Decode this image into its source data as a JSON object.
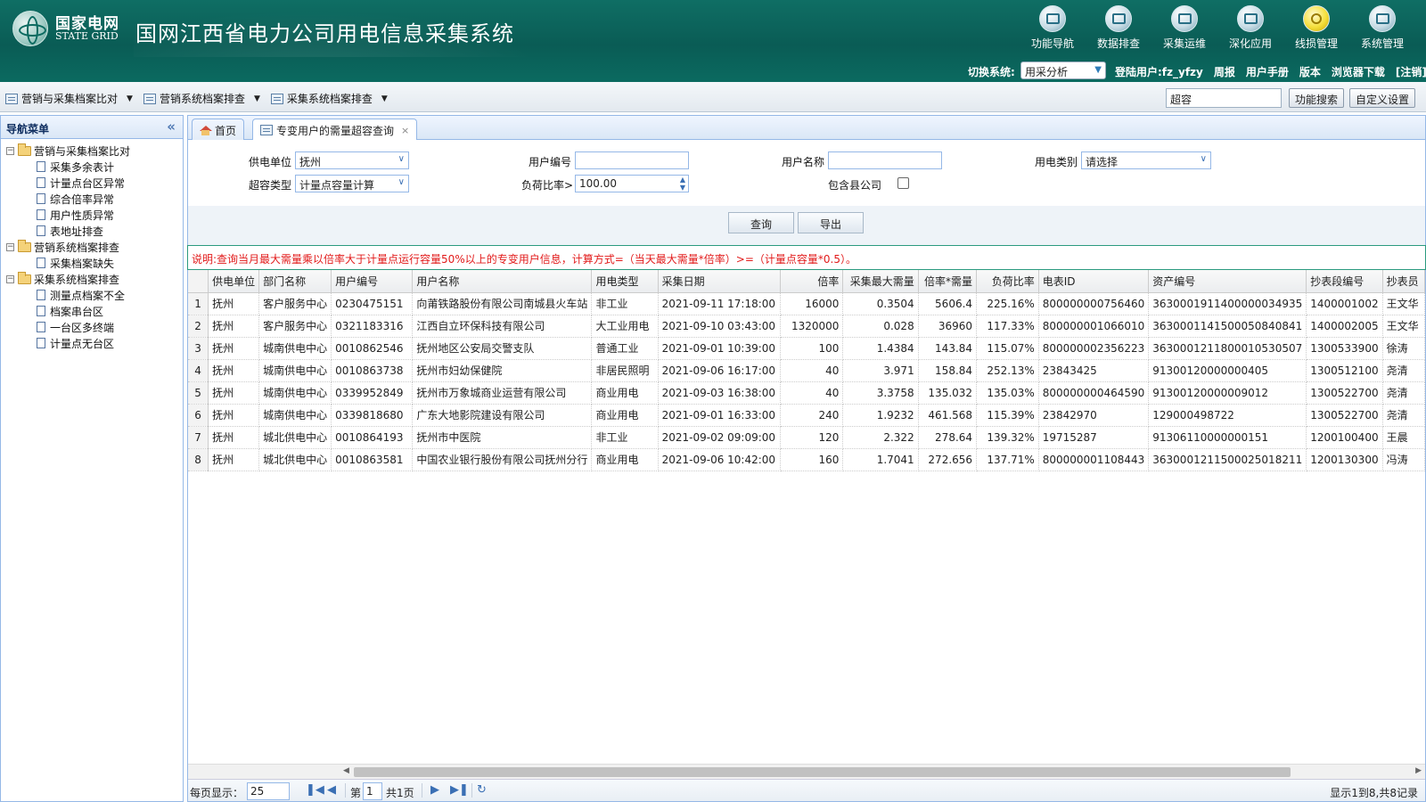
{
  "header": {
    "logo_cn": "国家电网",
    "logo_en": "STATE GRID",
    "system_title": "国网江西省电力公司用电信息采集系统",
    "nav": [
      {
        "label": "功能导航",
        "icon": "navigation-icon"
      },
      {
        "label": "数据排查",
        "icon": "data-check-icon"
      },
      {
        "label": "采集运维",
        "icon": "maintenance-icon"
      },
      {
        "label": "深化应用",
        "icon": "application-icon"
      },
      {
        "label": "线损管理",
        "icon": "bulb-icon"
      },
      {
        "label": "系统管理",
        "icon": "system-icon"
      }
    ],
    "switch_label": "切换系统:",
    "switch_value": "用采分析",
    "login_user": "登陆用户:fz_yfzy",
    "links": [
      "周报",
      "用户手册",
      "版本",
      "浏览器下载",
      "[注销]"
    ]
  },
  "toolbar": {
    "menus": [
      "营销与采集档案比对",
      "营销系统档案排查",
      "采集系统档案排查"
    ],
    "search_value": "超容",
    "search_button": "功能搜索",
    "custom_button": "自定义设置"
  },
  "leftnav": {
    "title": "导航菜单",
    "groups": [
      {
        "label": "营销与采集档案比对",
        "items": [
          "采集多余表计",
          "计量点台区异常",
          "综合倍率异常",
          "用户性质异常",
          "表地址排查"
        ]
      },
      {
        "label": "营销系统档案排查",
        "items": [
          "采集档案缺失"
        ]
      },
      {
        "label": "采集系统档案排查",
        "items": [
          "测量点档案不全",
          "档案串台区",
          "一台区多终端",
          "计量点无台区"
        ]
      }
    ]
  },
  "tabs": {
    "home": "首页",
    "active": "专变用户的需量超容查询"
  },
  "query": {
    "supply_unit_label": "供电单位",
    "supply_unit_value": "抚州",
    "user_no_label": "用户编号",
    "user_no_value": "",
    "user_name_label": "用户名称",
    "user_name_value": "",
    "elec_type_label": "用电类别",
    "elec_type_value": "请选择",
    "over_type_label": "超容类型",
    "over_type_value": "计量点容量计算",
    "load_ratio_label": "负荷比率>",
    "load_ratio_value": "100.00",
    "include_county_label": "包含县公司",
    "query_button": "查询",
    "export_button": "导出"
  },
  "notice": "说明:查询当月最大需量乘以倍率大于计量点运行容量50%以上的专变用户信息，计算方式=（当天最大需量*倍率）>=（计量点容量*0.5）。",
  "table": {
    "columns": [
      "",
      "供电单位",
      "部门名称",
      "用户编号",
      "用户名称",
      "用电类型",
      "采集日期",
      "倍率",
      "采集最大需量",
      "倍率*需量",
      "负荷比率",
      "电表ID",
      "资产编号",
      "抄表段编号",
      "抄表员"
    ],
    "rows": [
      [
        "1",
        "抚州",
        "客户服务中心",
        "0230475151",
        "向莆铁路股份有限公司南城县火车站",
        "非工业",
        "2021-09-11 17:18:00",
        "16000",
        "0.3504",
        "5606.4",
        "225.16%",
        "800000000756460",
        "3630001911400000034935",
        "1400001002",
        "王文华"
      ],
      [
        "2",
        "抚州",
        "客户服务中心",
        "0321183316",
        "江西自立环保科技有限公司",
        "大工业用电",
        "2021-09-10 03:43:00",
        "1320000",
        "0.028",
        "36960",
        "117.33%",
        "800000001066010",
        "3630001141500050840841",
        "1400002005",
        "王文华"
      ],
      [
        "3",
        "抚州",
        "城南供电中心",
        "0010862546",
        "抚州地区公安局交警支队",
        "普通工业",
        "2021-09-01 10:39:00",
        "100",
        "1.4384",
        "143.84",
        "115.07%",
        "800000002356223",
        "3630001211800010530507",
        "1300533900",
        "徐涛"
      ],
      [
        "4",
        "抚州",
        "城南供电中心",
        "0010863738",
        "抚州市妇幼保健院",
        "非居民照明",
        "2021-09-06 16:17:00",
        "40",
        "3.971",
        "158.84",
        "252.13%",
        "23843425",
        "91300120000000405",
        "1300512100",
        "尧清"
      ],
      [
        "5",
        "抚州",
        "城南供电中心",
        "0339952849",
        "抚州市万象城商业运营有限公司",
        "商业用电",
        "2021-09-03 16:38:00",
        "40",
        "3.3758",
        "135.032",
        "135.03%",
        "800000000464590",
        "91300120000009012",
        "1300522700",
        "尧清"
      ],
      [
        "6",
        "抚州",
        "城南供电中心",
        "0339818680",
        "广东大地影院建设有限公司",
        "商业用电",
        "2021-09-01 16:33:00",
        "240",
        "1.9232",
        "461.568",
        "115.39%",
        "23842970",
        "129000498722",
        "1300522700",
        "尧清"
      ],
      [
        "7",
        "抚州",
        "城北供电中心",
        "0010864193",
        "抚州市中医院",
        "非工业",
        "2021-09-02 09:09:00",
        "120",
        "2.322",
        "278.64",
        "139.32%",
        "19715287",
        "91306110000000151",
        "1200100400",
        "王晨"
      ],
      [
        "8",
        "抚州",
        "城北供电中心",
        "0010863581",
        "中国农业银行股份有限公司抚州分行",
        "商业用电",
        "2021-09-06 10:42:00",
        "160",
        "1.7041",
        "272.656",
        "137.71%",
        "800000001108443",
        "3630001211500025018211",
        "1200130300",
        "冯涛"
      ]
    ]
  },
  "pager": {
    "page_size_label": "每页显示：",
    "page_size": "25",
    "page_prefix": "第",
    "page_value": "1",
    "page_total": "共1页",
    "summary": "显示1到8,共8记录"
  }
}
